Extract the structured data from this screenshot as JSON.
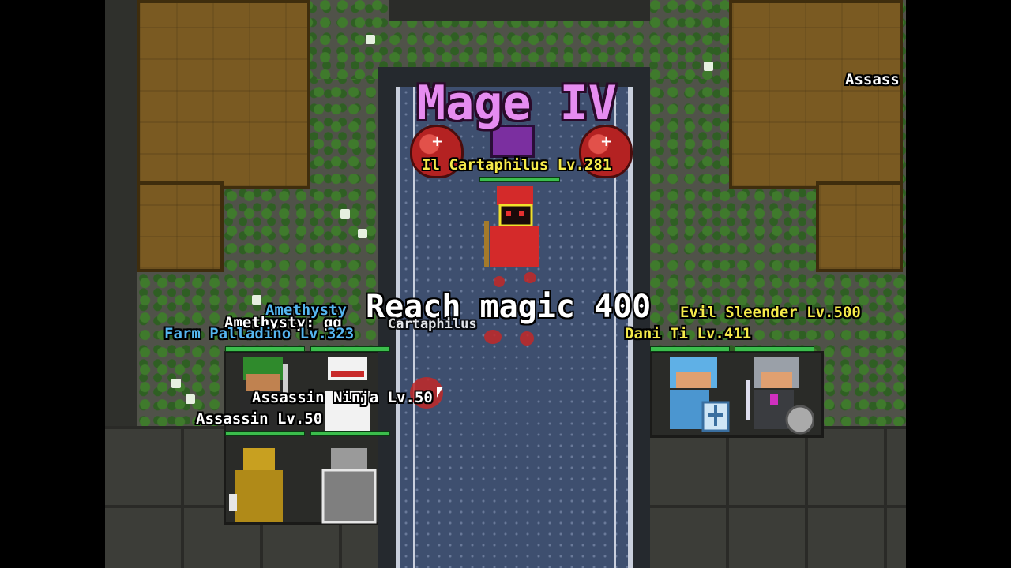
{
  "hud": {
    "class_title": "Mage IV",
    "goal_text": "Reach magic 400"
  },
  "players": {
    "mage": "Il Cartaphilus Lv.281",
    "evil_sleender": "Evil Sleender Lv.500",
    "dani": "Dani Ti Lv.411",
    "farm": "Farm Palladino Lv.323",
    "amethysty_name": "Amethysty",
    "cartaphilus_echo": "Cartaphilus",
    "assassin_ninja": "Assassin Ninja Lv.50",
    "assassin": "Assassin Lv.50",
    "offscreen": "Assass"
  },
  "chat": {
    "amethysty_msg": "Amethysty: gg"
  },
  "colors": {
    "title": "#e68cf0",
    "name_yellow": "#f5ea4a",
    "name_blue": "#55b6f0",
    "hp_bar": "#3bbd4c"
  }
}
